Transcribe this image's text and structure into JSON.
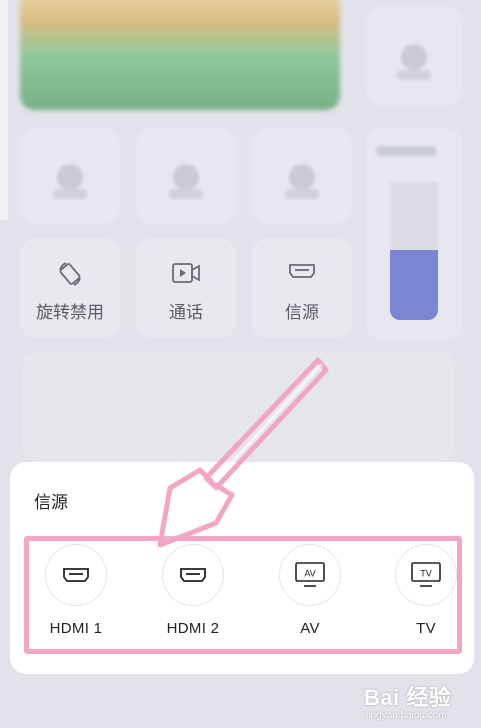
{
  "control_tiles": [
    {
      "label": "旋转禁用",
      "icon": "rotate-lock-icon"
    },
    {
      "label": "通话",
      "icon": "video-call-icon"
    },
    {
      "label": "信源",
      "icon": "hdmi-icon"
    }
  ],
  "sheet": {
    "title": "信源",
    "sources": [
      {
        "label": "HDMI 1",
        "icon": "hdmi-icon"
      },
      {
        "label": "HDMI 2",
        "icon": "hdmi-icon"
      },
      {
        "label": "AV",
        "icon": "av-icon",
        "icon_text": "AV"
      },
      {
        "label": "TV",
        "icon": "tv-icon",
        "icon_text": "TV"
      }
    ]
  },
  "watermark": {
    "brand": "Bai 经验",
    "url": "jingyan.baidu.com"
  },
  "colors": {
    "highlight": "#f2a6c4",
    "volume_fill": "#7a85d4"
  }
}
